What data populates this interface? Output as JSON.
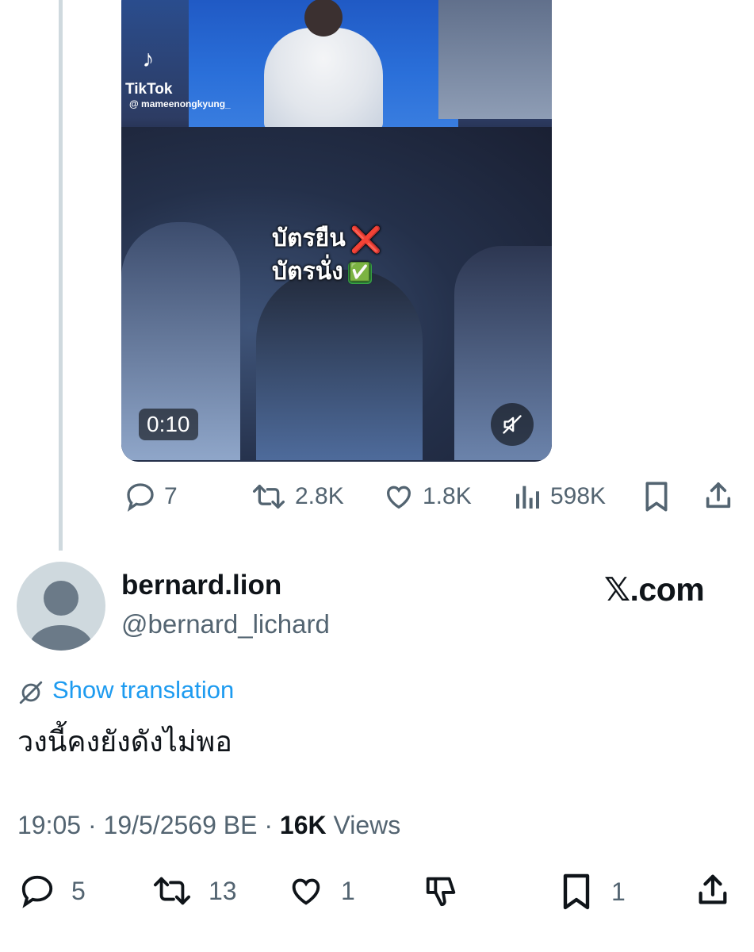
{
  "video": {
    "tiktok_label": "TikTok",
    "tiktok_handle": "@ mameenongkyung_",
    "overlay_line1": "บัตรยืน",
    "overlay_line2": "บัตรนั่ง",
    "overlay_mark1": "❌",
    "overlay_mark2": "✅",
    "duration": "0:10"
  },
  "parent_actions": {
    "replies": "7",
    "reposts": "2.8K",
    "likes": "1.8K",
    "views": "598K"
  },
  "reply_tweet": {
    "display_name": "bernard.lion",
    "handle": "@bernard_lichard",
    "watermark": "𝕏.com",
    "show_translation": "Show translation",
    "text": "วงนี้คงยังดังไม่พอ",
    "time": "19:05",
    "separator": "·",
    "date": "19/5/2569 BE",
    "views_count": "16K",
    "views_label": "Views"
  },
  "reply_actions": {
    "replies": "5",
    "reposts": "13",
    "likes": "1",
    "bookmarks": "1"
  },
  "colors": {
    "text_primary": "#0f1419",
    "text_secondary": "#536471",
    "link": "#1d9bf0",
    "thread_line": "#cfd9de"
  }
}
